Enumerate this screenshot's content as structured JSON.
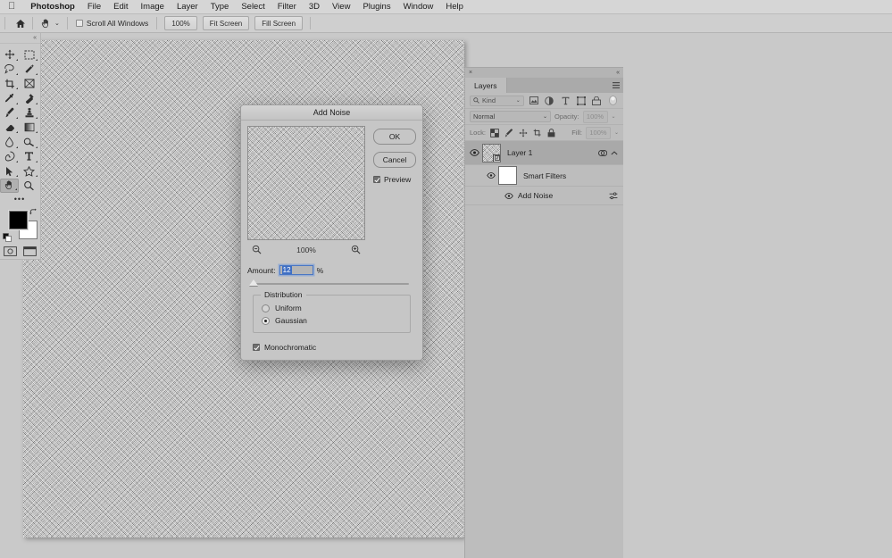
{
  "menubar": {
    "apple_glyph": "",
    "items": [
      {
        "label": "Photoshop",
        "bold": true
      },
      {
        "label": "File"
      },
      {
        "label": "Edit"
      },
      {
        "label": "Image"
      },
      {
        "label": "Layer"
      },
      {
        "label": "Type"
      },
      {
        "label": "Select"
      },
      {
        "label": "Filter"
      },
      {
        "label": "3D"
      },
      {
        "label": "View"
      },
      {
        "label": "Plugins"
      },
      {
        "label": "Window"
      },
      {
        "label": "Help"
      }
    ]
  },
  "options_bar": {
    "home_icon": "home-icon",
    "active_tool_icon": "hand-tool-icon",
    "tool_preset_caret": "⌄",
    "scroll_all_windows": {
      "label": "Scroll All Windows",
      "checked": false
    },
    "buttons": [
      {
        "label": "100%"
      },
      {
        "label": "Fit Screen"
      },
      {
        "label": "Fill Screen"
      }
    ]
  },
  "toolbar": {
    "collapse_glyph": "«",
    "tools": [
      {
        "name": "move-tool",
        "icon": "move-icon",
        "selected": false,
        "has_flyout": true
      },
      {
        "name": "rectangular-marquee-tool",
        "icon": "marquee-icon",
        "selected": false,
        "has_flyout": true
      },
      {
        "name": "lasso-tool",
        "icon": "lasso-icon",
        "selected": false,
        "has_flyout": true
      },
      {
        "name": "magic-wand-tool",
        "icon": "magic-wand-icon",
        "selected": false,
        "has_flyout": true
      },
      {
        "name": "crop-tool",
        "icon": "crop-icon",
        "selected": false,
        "has_flyout": true
      },
      {
        "name": "frame-tool",
        "icon": "frame-icon",
        "selected": false,
        "has_flyout": false
      },
      {
        "name": "eyedropper-tool",
        "icon": "eyedropper-icon",
        "selected": false,
        "has_flyout": true
      },
      {
        "name": "spot-healing-brush-tool",
        "icon": "healing-brush-icon",
        "selected": false,
        "has_flyout": true
      },
      {
        "name": "brush-tool",
        "icon": "brush-icon",
        "selected": false,
        "has_flyout": true
      },
      {
        "name": "clone-stamp-tool",
        "icon": "clone-stamp-icon",
        "selected": false,
        "has_flyout": true
      },
      {
        "name": "eraser-tool",
        "icon": "eraser-icon",
        "selected": false,
        "has_flyout": true
      },
      {
        "name": "gradient-tool",
        "icon": "gradient-icon",
        "selected": false,
        "has_flyout": true
      },
      {
        "name": "blur-tool",
        "icon": "blur-drop-icon",
        "selected": false,
        "has_flyout": true
      },
      {
        "name": "dodge-tool",
        "icon": "dodge-icon",
        "selected": false,
        "has_flyout": true
      },
      {
        "name": "pen-tool",
        "icon": "pen-icon",
        "selected": false,
        "has_flyout": true
      },
      {
        "name": "type-tool",
        "icon": "type-t-icon",
        "selected": false,
        "has_flyout": true
      },
      {
        "name": "path-selection-tool",
        "icon": "path-arrow-icon",
        "selected": false,
        "has_flyout": true
      },
      {
        "name": "shape-tool",
        "icon": "custom-shape-icon",
        "selected": false,
        "has_flyout": true
      },
      {
        "name": "hand-tool",
        "icon": "hand-icon",
        "selected": true,
        "has_flyout": true
      },
      {
        "name": "zoom-tool",
        "icon": "magnifier-icon",
        "selected": false,
        "has_flyout": false
      }
    ],
    "edit_toolbar_glyph": "•••",
    "colors": {
      "foreground": "#000000",
      "background": "#ffffff",
      "swap_icon": "swap-colors-icon",
      "default_icon": "default-colors-icon"
    },
    "modes": [
      {
        "name": "quick-mask-button",
        "icon": "quick-mask-icon"
      },
      {
        "name": "screen-mode-button",
        "icon": "screen-mode-icon"
      }
    ]
  },
  "dialog": {
    "title": "Add Noise",
    "preview_thumbnail": "noise-preview",
    "ok_label": "OK",
    "cancel_label": "Cancel",
    "preview_checkbox": {
      "label": "Preview",
      "checked": true
    },
    "zoom_out_icon": "zoom-out-icon",
    "zoom_in_icon": "zoom-in-icon",
    "zoom_level": "100%",
    "amount": {
      "label": "Amount:",
      "value": "12",
      "unit": "%",
      "selected": true,
      "slider_position_pct": 0
    },
    "distribution": {
      "legend": "Distribution",
      "options": [
        {
          "label": "Uniform",
          "selected": false
        },
        {
          "label": "Gaussian",
          "selected": true
        }
      ]
    },
    "monochromatic": {
      "label": "Monochromatic",
      "checked": true
    }
  },
  "panel": {
    "close_glyph": "×",
    "collapse_glyph": "«",
    "tabs": [
      {
        "label": "Layers",
        "active": true
      }
    ],
    "menu_icon": "panel-menu-icon",
    "filter": {
      "search_icon": "search-icon",
      "kind_label": "Kind",
      "caret": "⌄",
      "icons": [
        {
          "name": "filter-pixel-icon"
        },
        {
          "name": "filter-adjustment-icon"
        },
        {
          "name": "filter-type-icon"
        },
        {
          "name": "filter-shape-icon"
        },
        {
          "name": "filter-smartobject-icon"
        }
      ],
      "toggle_icon": "filter-toggle-icon"
    },
    "blend": {
      "mode": "Normal",
      "caret": "⌄",
      "opacity_label": "Opacity:",
      "opacity_value": "100%",
      "fill_label": "Fill:",
      "fill_value": "100%"
    },
    "lock": {
      "label": "Lock:",
      "icons": [
        {
          "name": "lock-transparent-pixels-icon"
        },
        {
          "name": "lock-image-pixels-icon"
        },
        {
          "name": "lock-position-icon"
        },
        {
          "name": "lock-artboard-icon"
        },
        {
          "name": "lock-all-icon"
        }
      ]
    },
    "layers": [
      {
        "name": "Layer 1",
        "visible": true,
        "selected": true,
        "thumb_type": "noise",
        "smart_object_badge": true,
        "right_icons": [
          "smart-filter-icon",
          "collapse-chevron-icon"
        ]
      },
      {
        "name": "Smart Filters",
        "visible": true,
        "selected": false,
        "thumb_type": "white-mask",
        "smart_object_badge": false,
        "indent": 1,
        "right_icons": []
      },
      {
        "name": "Add Noise",
        "visible": true,
        "selected": false,
        "thumb_type": "none",
        "smart_object_badge": false,
        "indent": 2,
        "right_icons": [
          "blending-options-icon"
        ]
      }
    ]
  },
  "document": {
    "content": "noise-image"
  }
}
